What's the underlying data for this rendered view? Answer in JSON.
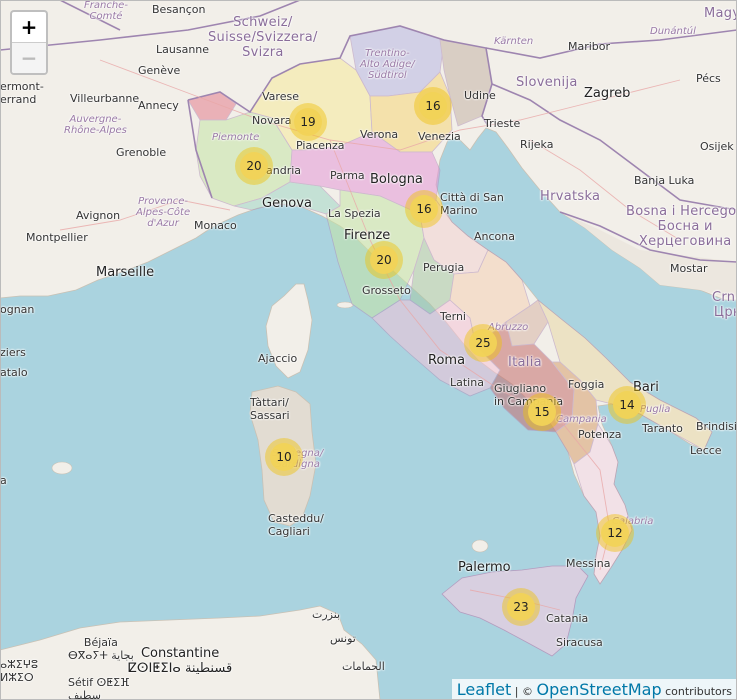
{
  "map": {
    "zoom_in_label": "+",
    "zoom_out_label": "−",
    "attribution": {
      "leaflet": "Leaflet",
      "separator": " | © ",
      "osm": "OpenStreetMap",
      "suffix": " contributors"
    },
    "colors": {
      "sea": "#aad3df",
      "land": "#f2efe9",
      "cluster_outer": "#f0c20c",
      "cluster_inner": "#f1d357"
    },
    "clusters": [
      {
        "id": "lombardia",
        "count": "19"
      },
      {
        "id": "veneto",
        "count": "16"
      },
      {
        "id": "piemonte",
        "count": "20"
      },
      {
        "id": "emilia-romagna",
        "count": "16"
      },
      {
        "id": "toscana",
        "count": "20"
      },
      {
        "id": "lazio",
        "count": "25"
      },
      {
        "id": "campania",
        "count": "15"
      },
      {
        "id": "puglia",
        "count": "14"
      },
      {
        "id": "sardegna",
        "count": "10"
      },
      {
        "id": "calabria",
        "count": "12"
      },
      {
        "id": "sicilia",
        "count": "23"
      }
    ],
    "labels": {
      "franche_comte": "Franche-\nComté",
      "besancon": "Besançon",
      "schweiz": "Schweiz/\nSuisse/Svizzera/\nSvizra",
      "trentino": "Trentino-\nAlto Adige/\nSüdtirol",
      "karnten": "Kärnten",
      "maribor": "Maribor",
      "dunantul": "Dunántúl",
      "magy": "Magy",
      "lausanne": "Lausanne",
      "geneve": "Genève",
      "ermont": "ermont-\nerrand",
      "villeurbanne": "Villeurbanne",
      "annecy": "Annecy",
      "auvergne": "Auvergne-\nRhône-Alpes",
      "varese": "Varese",
      "novara": "Novara",
      "udine": "Udine",
      "slovenija": "Slovenija",
      "pecs": "Pécs",
      "zagreb": "Zagreb",
      "trieste": "Trieste",
      "grenoble": "Grenoble",
      "piemonte": "Piemonte",
      "verona": "Verona",
      "venezia": "Venezia",
      "piacenza": "Piacenza",
      "rijeka": "Rijeka",
      "osijek": "Osijek",
      "alessandria": "andria",
      "parma": "Parma",
      "bologna": "Bologna",
      "banja_luka": "Banja Luka",
      "provence": "Provence-\nAlpes-Côte\nd'Azur",
      "avignon": "Avignon",
      "genova": "Genova",
      "hrvatska": "Hrvatska",
      "san_marino": "Città di San\nMarino",
      "bosna": "Bosna i Hercegov\nБосна и\nХерцеговина",
      "monaco": "Monaco",
      "la_spezia": "La Spezia",
      "montpellier": "Montpellier",
      "firenze": "Firenze",
      "ancona": "Ancona",
      "marseille": "Marseille",
      "perugia": "Perugia",
      "mostar": "Mostar",
      "crna": "Crna\nЦрн",
      "ognan": "ognan",
      "grosseto": "Grosseto",
      "terni": "Terni",
      "abruzzo": "Abruzzo",
      "beziers": "ziers",
      "ajaccio": "Ajaccio",
      "roma": "Roma",
      "italia": "Italia",
      "foggia": "Foggia",
      "bari": "Bari",
      "catalo": "atalo",
      "latina": "Latina",
      "giugliano": "Giugliano\nin Campania",
      "tattari": "Tàttari/\nSassari",
      "puglia": "Puglia",
      "campania": "Campania",
      "taranto": "Taranto",
      "brindisi": "Brindisi",
      "potenza": "Potenza",
      "lecce": "Lecce",
      "sardegna": "Sardegna/\nSardigna",
      "sa": "a",
      "casteddu": "Casteddu/\nCagliari",
      "calabria": "Calabria",
      "palermo": "Palermo",
      "messina": "Messina",
      "bizerte": "بنزرت",
      "tunis": "تونس",
      "catania": "Catania",
      "siracusa": "Siracusa",
      "bejaia": "Béjaïa\nⴱⴳⴰⵢⵜ بجاية",
      "constantine": "Constantine\nⵇⵙⵏⵟⵉⵏⴰ قسنطينة",
      "setif": "Sétif ⵙⵟⵉⴼ\nسطيف",
      "tizi": "ⴰⵣⵉⵖⵓ\nⵍⵣⵉⵔ",
      "hammamet": "الحمامات"
    }
  }
}
